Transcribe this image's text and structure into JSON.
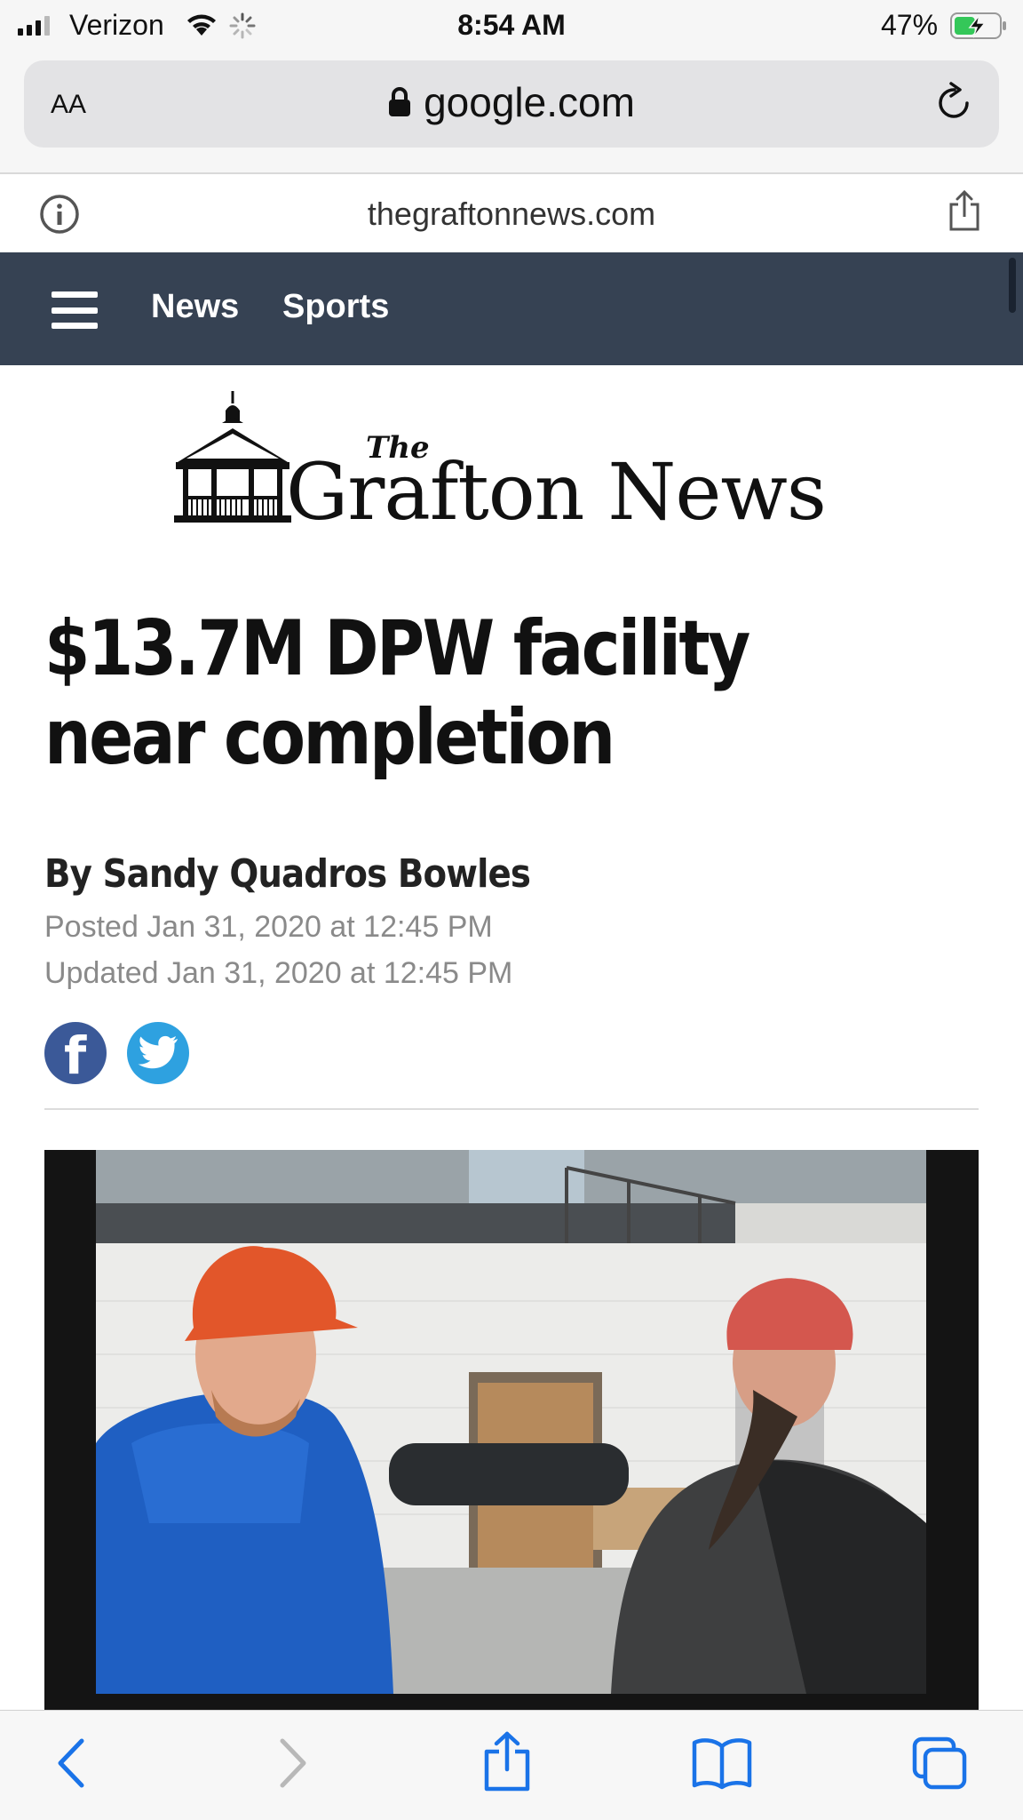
{
  "status_bar": {
    "carrier": "Verizon",
    "time": "8:54 AM",
    "battery_percent": "47%",
    "battery_level": 0.47,
    "icons": [
      "signal-icon",
      "wifi-icon",
      "activity-spinner-icon",
      "battery-charging-icon"
    ]
  },
  "address_bar": {
    "text_size_label": "AA",
    "url": "google.com",
    "icons": [
      "lock-icon",
      "reload-icon"
    ]
  },
  "site_bar": {
    "domain": "thegraftonnews.com",
    "icons": [
      "info-icon",
      "share-icon"
    ]
  },
  "nav": {
    "menu_icon": "hamburger-icon",
    "links": [
      "News",
      "Sports"
    ]
  },
  "logo": {
    "the": "The",
    "name": "Grafton News"
  },
  "article": {
    "headline": "$13.7M DPW facility near completion",
    "byline": "By Sandy Quadros Bowles",
    "posted": "Posted Jan 31, 2020 at 12:45 PM",
    "updated": "Updated Jan 31, 2020 at 12:45 PM",
    "share_icons": [
      "facebook-icon",
      "twitter-icon"
    ],
    "photo": "photo of two men in hard hats inside a building under construction"
  },
  "toolbar": {
    "icons": [
      "back-icon",
      "forward-icon",
      "share-icon",
      "bookmarks-icon",
      "tabs-icon"
    ]
  },
  "colors": {
    "nav_bg": "#364253",
    "facebook": "#3b5998",
    "twitter": "#2ea1e0",
    "ios_blue": "#1a73e8"
  }
}
